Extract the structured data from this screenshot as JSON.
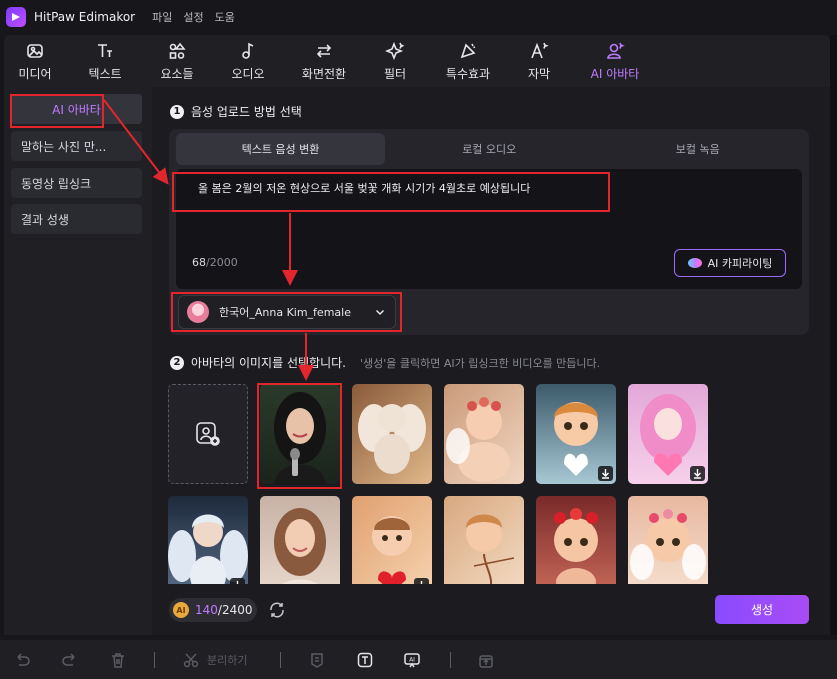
{
  "app": {
    "title": "HitPaw Edimakor",
    "menu": [
      "파일",
      "설정",
      "도움"
    ]
  },
  "toolbar": {
    "items": [
      {
        "label": "미디어",
        "icon": "media-icon"
      },
      {
        "label": "텍스트",
        "icon": "text-icon"
      },
      {
        "label": "요소들",
        "icon": "elements-icon"
      },
      {
        "label": "오디오",
        "icon": "audio-icon"
      },
      {
        "label": "화면전환",
        "icon": "transition-icon"
      },
      {
        "label": "필터",
        "icon": "filter-icon"
      },
      {
        "label": "특수효과",
        "icon": "effects-icon"
      },
      {
        "label": "자막",
        "icon": "subtitle-icon"
      },
      {
        "label": "AI 아바타",
        "icon": "ai-avatar-icon",
        "active": true
      }
    ]
  },
  "sidebar": {
    "items": [
      {
        "label": "AI 아바타",
        "active": true
      },
      {
        "label": "말하는 사진 만..."
      },
      {
        "label": "동영상 립싱크"
      },
      {
        "label": "결과 성생"
      }
    ]
  },
  "step1": {
    "num": "1",
    "title": "음성 업로드 방법 선택",
    "tabs": [
      "텍스트 음성 변환",
      "로컬 오디오",
      "보컬 녹음"
    ],
    "active_tab": 0,
    "text": "올 봄은 2월의 저온 현상으로 서울 벚꽃 개화 시기가 4월초로 예상됩니다",
    "count_current": "68",
    "count_max": "/2000",
    "copy_button": "AI 카피라이팅",
    "voice": "한국어_Anna Kim_female"
  },
  "step2": {
    "num": "2",
    "title": "아바타의 이미지를 선택합니다.",
    "hint": "'생성'을 클릭하면 AI가 립싱크한 비디오를 만듭니다."
  },
  "avatars": [
    {
      "name": "avatar-woman-microphone",
      "selected": true,
      "download": false
    },
    {
      "name": "avatar-cupid-statue",
      "download": false
    },
    {
      "name": "avatar-cupid-baby-flowers",
      "download": false
    },
    {
      "name": "avatar-cartoon-baby-heart",
      "download": true
    },
    {
      "name": "avatar-pink-hair-girl",
      "download": true
    },
    {
      "name": "avatar-angel-boy",
      "download": true
    },
    {
      "name": "avatar-smiling-woman",
      "download": false
    },
    {
      "name": "avatar-baby-red-heart",
      "download": true
    },
    {
      "name": "avatar-cupid-bow",
      "download": false
    },
    {
      "name": "avatar-cartoon-cupid-roses",
      "download": false
    },
    {
      "name": "avatar-cartoon-cupid-flowers",
      "download": false
    }
  ],
  "footer": {
    "coin_label": "AI",
    "credits_used": "140",
    "credits_total": "/2400",
    "generate": "생성"
  },
  "bottombar": {
    "split_label": "분리하기"
  },
  "colors": {
    "accent": "#c07cff",
    "annotation": "#e3262e",
    "generate_button": "#8a4bff"
  }
}
